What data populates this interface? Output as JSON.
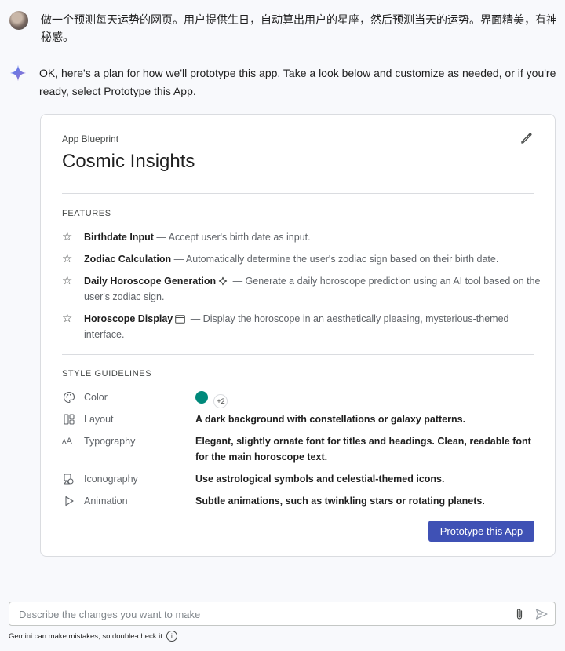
{
  "conversation": {
    "user_prompt": "做一个预测每天运势的网页。用户提供生日，自动算出用户的星座，然后预测当天的运势。界面精美，有神秘感。",
    "assistant_intro": "OK, here's a plan for how we'll prototype this app. Take a look below and customize as needed, or if you're ready, select Prototype this App."
  },
  "blueprint": {
    "eyebrow": "App Blueprint",
    "title": "Cosmic Insights",
    "features_label": "FEATURES",
    "features": [
      {
        "name": "Birthdate Input",
        "desc": " — Accept user's birth date as input."
      },
      {
        "name": "Zodiac Calculation",
        "desc": " — Automatically determine the user's zodiac sign based on their birth date."
      },
      {
        "name": "Daily Horoscope Generation",
        "desc": " — Generate a daily horoscope prediction using an AI tool based on the user's zodiac sign."
      },
      {
        "name": "Horoscope Display",
        "desc": " — Display the horoscope in an aesthetically pleasing, mysterious-themed interface."
      }
    ],
    "style_label": "STYLE GUIDELINES",
    "style": {
      "color": {
        "label": "Color",
        "swatch": "#00897b",
        "more": "+2"
      },
      "layout": {
        "label": "Layout",
        "value": "A dark background with constellations or galaxy patterns."
      },
      "typography": {
        "label": "Typography",
        "value": "Elegant, slightly ornate font for titles and headings. Clean, readable font for the main horoscope text."
      },
      "iconography": {
        "label": "Iconography",
        "value": "Use astrological symbols and celestial-themed icons."
      },
      "animation": {
        "label": "Animation",
        "value": "Subtle animations, such as twinkling stars or rotating planets."
      }
    },
    "prototype_button": "Prototype this App"
  },
  "composer": {
    "placeholder": "Describe the changes you want to make",
    "disclaimer": "Gemini can make mistakes, so double-check it"
  },
  "colors": {
    "accent": "#3f51b5",
    "spark": "#4285f4"
  }
}
